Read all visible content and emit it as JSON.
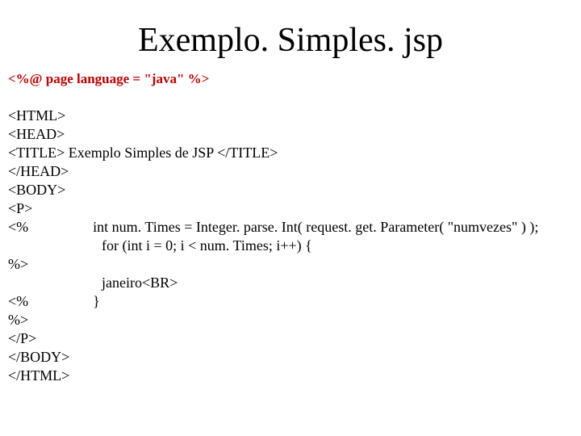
{
  "title": "Exemplo. Simples. jsp",
  "directive": "<%@ page language = \"java\" %>",
  "code": {
    "l1": "<HTML>",
    "l2": "<HEAD>",
    "l3": "<TITLE> Exemplo Simples de JSP </TITLE>",
    "l4": "</HEAD>",
    "l5": "<BODY>",
    "l6": "<P>",
    "l7a": "<%",
    "l7b": "int num. Times = Integer. parse. Int( request. get. Parameter( \"numvezes\" ) );",
    "l8": "for (int i = 0; i < num. Times; i++) {",
    "l9": "%>",
    "l10": "janeiro<BR>",
    "l11a": "<%",
    "l11b": "}",
    "l12": "%>",
    "l13": "</P>",
    "l14": "</BODY>",
    "l15": "</HTML>"
  }
}
